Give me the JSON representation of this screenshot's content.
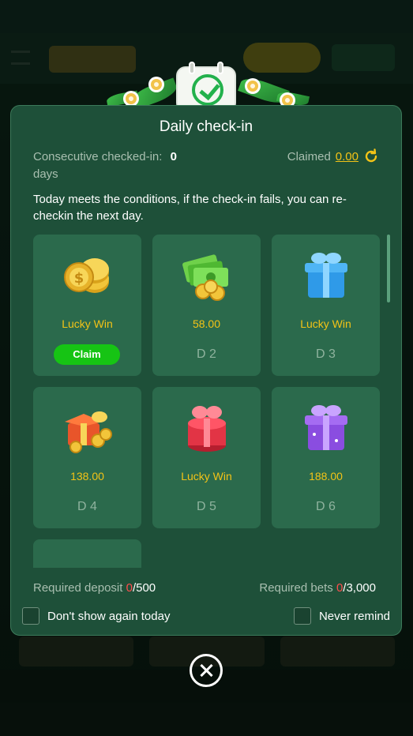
{
  "modal": {
    "title": "Daily check-in",
    "consecutive_label": "Consecutive checked-in:",
    "consecutive_value": "0",
    "consecutive_unit": "days",
    "claimed_label": "Claimed",
    "claimed_value": "0.00",
    "notice": "Today meets the conditions, if the check-in fails, you can re-checkin the next day."
  },
  "rewards": [
    {
      "label": "Lucky Win",
      "action": "Claim",
      "icon": "gold-coin-stack"
    },
    {
      "label": "58.00",
      "day": "D 2",
      "icon": "cash-and-coins"
    },
    {
      "label": "Lucky Win",
      "day": "D 3",
      "icon": "blue-gift-box"
    },
    {
      "label": "138.00",
      "day": "D 4",
      "icon": "open-red-gift-with-coins"
    },
    {
      "label": "Lucky Win",
      "day": "D 5",
      "icon": "red-gift-box"
    },
    {
      "label": "188.00",
      "day": "D 6",
      "icon": "purple-gift-box"
    },
    {
      "label": "",
      "day": "",
      "icon": "gold-treasure"
    }
  ],
  "requirements": {
    "deposit_label": "Required deposit",
    "deposit_current": "0",
    "deposit_total": "/500",
    "bets_label": "Required bets",
    "bets_current": "0",
    "bets_total": "/3,000"
  },
  "options": {
    "dont_show_today": "Don't show again today",
    "never_remind": "Never remind"
  },
  "colors": {
    "accent_yellow": "#f3c317",
    "claim_green": "#16c414",
    "modal_bg": "#1e5039",
    "card_bg": "#2b6a4c",
    "warning_red": "#ff4d4d"
  }
}
